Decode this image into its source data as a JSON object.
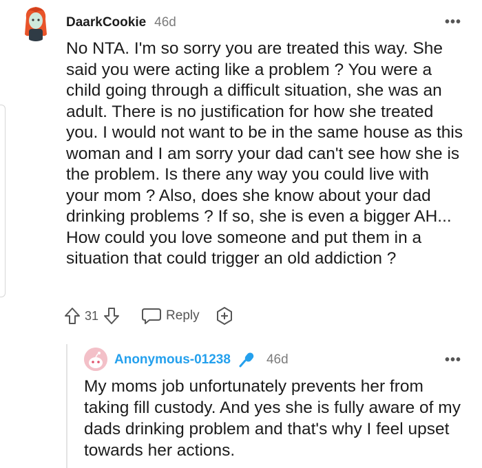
{
  "comment": {
    "author": "DaarkCookie",
    "age": "46d",
    "more_label": "•••",
    "body": "No NTA. I'm so sorry you are treated this way. She said you were acting like a problem ? You were a child going through a difficult situation, she was an adult. There is no justification for how she treated you. I would not want to be in the same house as this woman and I am sorry your dad can't see how she is the problem. Is there any way you could live with your mom ? Also, does she know about your dad drinking problems ? If so, she is even a bigger AH... How could you love someone and put them in a situation that could trigger an old addiction ?",
    "score": "31",
    "reply_label": "Reply",
    "icons": [
      "upvote-icon",
      "downvote-icon",
      "chat-bubble-icon",
      "award-plus-icon"
    ]
  },
  "reply": {
    "author": "Anonymous-01238",
    "age": "46d",
    "more_label": "•••",
    "body": "My moms job unfortunately prevents her from taking fill custody. And yes she is fully aware of my dads drinking problem and that's why I feel upset towards her actions.",
    "author_color": "#24a0ed",
    "icons": [
      "snoo-avatar-icon",
      "microphone-icon"
    ]
  }
}
